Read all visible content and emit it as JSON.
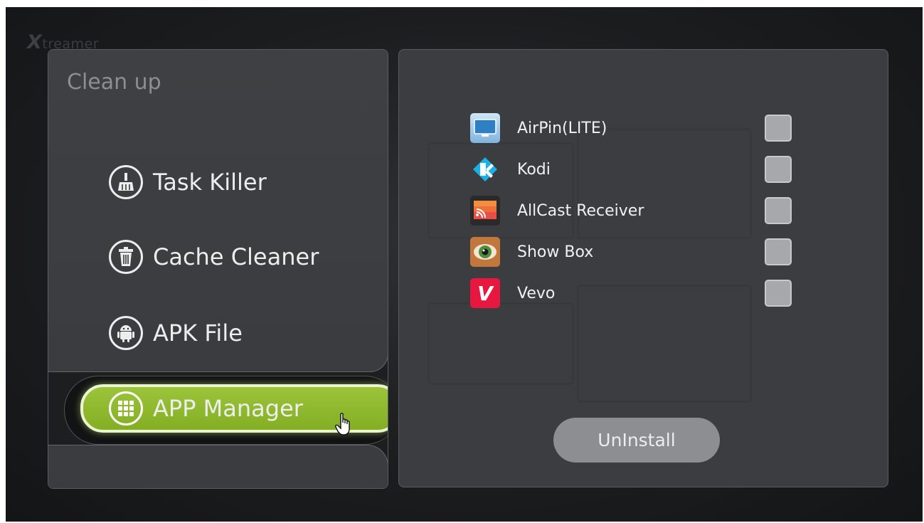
{
  "brand": {
    "logo_letter": "X",
    "logo_rest": "treamer"
  },
  "left_panel": {
    "title": "Clean up",
    "menu": [
      {
        "label": "Task Killer",
        "icon": "broom-icon"
      },
      {
        "label": "Cache Cleaner",
        "icon": "trash-icon"
      },
      {
        "label": "APK File",
        "icon": "android-icon"
      },
      {
        "label": "APP Manager",
        "icon": "grid-icon",
        "selected": true
      }
    ]
  },
  "right_panel": {
    "apps": [
      {
        "name": "AirPin(LITE)",
        "icon": "airpin-icon",
        "checked": false
      },
      {
        "name": "Kodi",
        "icon": "kodi-icon",
        "checked": false
      },
      {
        "name": "AllCast Receiver",
        "icon": "allcast-icon",
        "checked": false
      },
      {
        "name": "Show Box",
        "icon": "showbox-icon",
        "checked": false
      },
      {
        "name": "Vevo",
        "icon": "vevo-icon",
        "icon_letter": "V",
        "checked": false
      }
    ],
    "uninstall_label": "UnInstall"
  },
  "colors": {
    "accent_green": "#8ab82a",
    "panel_bg": "#3b3d40",
    "vevo_red": "#e8173f",
    "kodi_blue": "#17b2e7"
  }
}
